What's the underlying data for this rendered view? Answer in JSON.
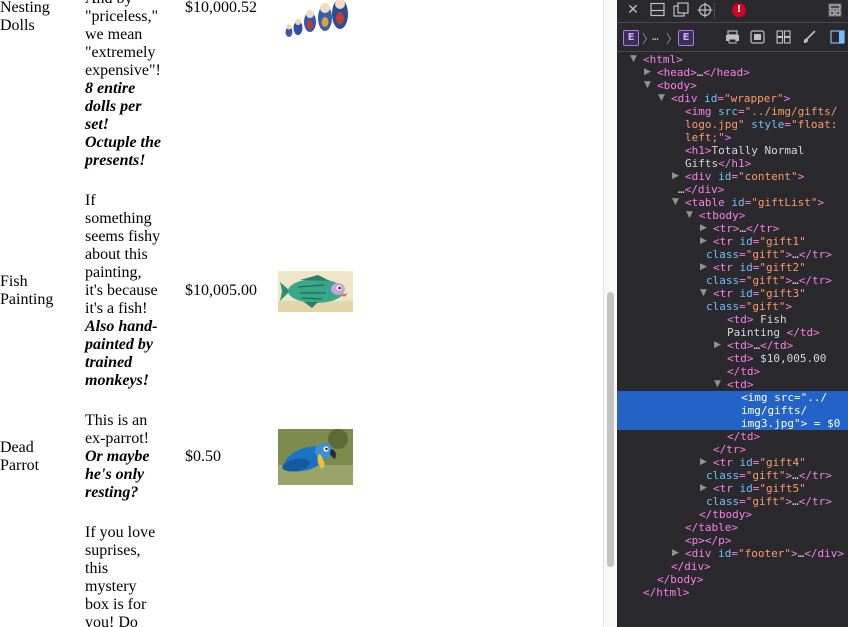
{
  "page": {
    "gifts": [
      {
        "name": "Nesting Dolls",
        "desc_lines": [
          "And by",
          "\"priceless,\"",
          "we mean",
          "\"extremely",
          "expensive\"!"
        ],
        "emph_lines": [
          "8 entire",
          "dolls per",
          "set!",
          "Octuple the",
          "presents!"
        ],
        "price": "$10,000.52",
        "image": "nesting dolls"
      },
      {
        "name": "Fish Painting",
        "desc_lines": [
          "If",
          "something",
          "seems fishy",
          "about this",
          "painting,",
          "it's because",
          "it's a fish!"
        ],
        "emph_lines": [
          "Also hand-",
          "painted by",
          "trained",
          "monkeys!"
        ],
        "price": "$10,005.00",
        "image": "fish painting"
      },
      {
        "name": "Dead Parrot",
        "desc_lines": [
          "This is an",
          "ex-parrot!"
        ],
        "emph_lines": [
          "Or maybe",
          "he's only",
          "resting?"
        ],
        "price": "$0.50",
        "image": "parrot"
      },
      {
        "name": "",
        "desc_lines": [
          "If you love",
          "suprises,",
          "this",
          "mystery",
          "box is for",
          "you! Do"
        ],
        "emph_lines": [],
        "price": "",
        "image": ""
      }
    ]
  },
  "devtools": {
    "toolbar_icons": [
      "close-icon",
      "dock-bottom-icon",
      "undock-icon",
      "pick-element-icon",
      "error-icon",
      "layout-icon"
    ],
    "error_badge": "!",
    "breadcrumb": {
      "left_badge": "E",
      "ellipsis": "…",
      "right_badge": "E"
    },
    "bar_icons": [
      "print-icon",
      "screenshot-icon",
      "grid-icon",
      "paint-brush-icon",
      "sidebar-icon"
    ],
    "selected_suffix": " = $0",
    "tree": [
      {
        "indent": 0,
        "arrow": "▼",
        "tokens": [
          [
            "tag",
            "<html>"
          ]
        ]
      },
      {
        "indent": 1,
        "arrow": "▶",
        "tokens": [
          [
            "tag",
            "<head>"
          ],
          [
            "txt",
            "…"
          ],
          [
            "tag",
            "</head>"
          ]
        ]
      },
      {
        "indent": 1,
        "arrow": "▼",
        "tokens": [
          [
            "tag",
            "<body>"
          ]
        ]
      },
      {
        "indent": 2,
        "arrow": "▼",
        "tokens": [
          [
            "tag",
            "<div "
          ],
          [
            "attr",
            "id"
          ],
          [
            "tag",
            "="
          ],
          [
            "val",
            "\"wrapper\""
          ],
          [
            "tag",
            ">"
          ]
        ]
      },
      {
        "indent": 3,
        "arrow": "",
        "tokens": [
          [
            "tag",
            "<img "
          ],
          [
            "attr",
            "src"
          ],
          [
            "tag",
            "="
          ],
          [
            "val",
            "\"../img/gifts/"
          ]
        ]
      },
      {
        "indent": 3,
        "arrow": "",
        "tokens": [
          [
            "val",
            "logo.jpg\" "
          ],
          [
            "attr",
            "style"
          ],
          [
            "tag",
            "="
          ],
          [
            "val",
            "\"float:"
          ]
        ]
      },
      {
        "indent": 3,
        "arrow": "",
        "tokens": [
          [
            "val",
            "left;\""
          ],
          [
            "tag",
            ">"
          ]
        ]
      },
      {
        "indent": 3,
        "arrow": "",
        "tokens": [
          [
            "tag",
            "<h1>"
          ],
          [
            "txt",
            "Totally Normal"
          ]
        ]
      },
      {
        "indent": 3,
        "arrow": "",
        "tokens": [
          [
            "txt",
            "Gifts"
          ],
          [
            "tag",
            "</h1>"
          ]
        ]
      },
      {
        "indent": 3,
        "arrow": "▶",
        "tokens": [
          [
            "tag",
            "<div "
          ],
          [
            "attr",
            "id"
          ],
          [
            "tag",
            "="
          ],
          [
            "val",
            "\"content\""
          ],
          [
            "tag",
            ">"
          ]
        ]
      },
      {
        "indent": 2.5,
        "arrow": "",
        "tokens": [
          [
            "txt",
            "…"
          ],
          [
            "tag",
            "</div>"
          ]
        ]
      },
      {
        "indent": 3,
        "arrow": "▼",
        "tokens": [
          [
            "tag",
            "<table "
          ],
          [
            "attr",
            "id"
          ],
          [
            "tag",
            "="
          ],
          [
            "val",
            "\"giftList\""
          ],
          [
            "tag",
            ">"
          ]
        ]
      },
      {
        "indent": 4,
        "arrow": "▼",
        "tokens": [
          [
            "tag",
            "<tbody>"
          ]
        ]
      },
      {
        "indent": 5,
        "arrow": "▶",
        "tokens": [
          [
            "tag",
            "<tr>"
          ],
          [
            "txt",
            "…"
          ],
          [
            "tag",
            "</tr>"
          ]
        ]
      },
      {
        "indent": 5,
        "arrow": "▶",
        "tokens": [
          [
            "tag",
            "<tr "
          ],
          [
            "attr",
            "id"
          ],
          [
            "tag",
            "="
          ],
          [
            "val",
            "\"gift1\""
          ]
        ]
      },
      {
        "indent": 4.5,
        "arrow": "",
        "tokens": [
          [
            "attr",
            "class"
          ],
          [
            "tag",
            "="
          ],
          [
            "val",
            "\"gift\""
          ],
          [
            "tag",
            ">"
          ],
          [
            "txt",
            "…"
          ],
          [
            "tag",
            "</tr>"
          ]
        ]
      },
      {
        "indent": 5,
        "arrow": "▶",
        "tokens": [
          [
            "tag",
            "<tr "
          ],
          [
            "attr",
            "id"
          ],
          [
            "tag",
            "="
          ],
          [
            "val",
            "\"gift2\""
          ]
        ]
      },
      {
        "indent": 4.5,
        "arrow": "",
        "tokens": [
          [
            "attr",
            "class"
          ],
          [
            "tag",
            "="
          ],
          [
            "val",
            "\"gift\""
          ],
          [
            "tag",
            ">"
          ],
          [
            "txt",
            "…"
          ],
          [
            "tag",
            "</tr>"
          ]
        ]
      },
      {
        "indent": 5,
        "arrow": "▼",
        "tokens": [
          [
            "tag",
            "<tr "
          ],
          [
            "attr",
            "id"
          ],
          [
            "tag",
            "="
          ],
          [
            "val",
            "\"gift3\""
          ]
        ]
      },
      {
        "indent": 4.5,
        "arrow": "",
        "tokens": [
          [
            "attr",
            "class"
          ],
          [
            "tag",
            "="
          ],
          [
            "val",
            "\"gift\""
          ],
          [
            "tag",
            ">"
          ]
        ]
      },
      {
        "indent": 6,
        "arrow": "",
        "tokens": [
          [
            "tag",
            "<td>"
          ],
          [
            "txt",
            " Fish"
          ]
        ]
      },
      {
        "indent": 6,
        "arrow": "",
        "tokens": [
          [
            "txt",
            "Painting "
          ],
          [
            "tag",
            "</td>"
          ]
        ]
      },
      {
        "indent": 6,
        "arrow": "▶",
        "tokens": [
          [
            "tag",
            "<td>"
          ],
          [
            "txt",
            "…"
          ],
          [
            "tag",
            "</td>"
          ]
        ]
      },
      {
        "indent": 6,
        "arrow": "",
        "tokens": [
          [
            "tag",
            "<td>"
          ],
          [
            "txt",
            " $10,005.00"
          ]
        ]
      },
      {
        "indent": 6,
        "arrow": "",
        "tokens": [
          [
            "tag",
            "</td>"
          ]
        ]
      },
      {
        "indent": 6,
        "arrow": "▼",
        "tokens": [
          [
            "tag",
            "<td>"
          ]
        ]
      },
      {
        "indent": 7,
        "arrow": "",
        "sel": true,
        "tokens": [
          [
            "tag",
            "<img "
          ],
          [
            "attr",
            "src"
          ],
          [
            "tag",
            "="
          ],
          [
            "val",
            "\"../"
          ]
        ]
      },
      {
        "indent": 7,
        "arrow": "",
        "sel": true,
        "tokens": [
          [
            "val",
            "img/gifts/"
          ]
        ]
      },
      {
        "indent": 7,
        "arrow": "",
        "sel": true,
        "last": true,
        "tokens": [
          [
            "val",
            "img3.jpg\""
          ],
          [
            "tag",
            ">"
          ]
        ]
      },
      {
        "indent": 6,
        "arrow": "",
        "tokens": [
          [
            "tag",
            "</td>"
          ]
        ]
      },
      {
        "indent": 5,
        "arrow": "",
        "tokens": [
          [
            "tag",
            "</tr>"
          ]
        ]
      },
      {
        "indent": 5,
        "arrow": "▶",
        "tokens": [
          [
            "tag",
            "<tr "
          ],
          [
            "attr",
            "id"
          ],
          [
            "tag",
            "="
          ],
          [
            "val",
            "\"gift4\""
          ]
        ]
      },
      {
        "indent": 4.5,
        "arrow": "",
        "tokens": [
          [
            "attr",
            "class"
          ],
          [
            "tag",
            "="
          ],
          [
            "val",
            "\"gift\""
          ],
          [
            "tag",
            ">"
          ],
          [
            "txt",
            "…"
          ],
          [
            "tag",
            "</tr>"
          ]
        ]
      },
      {
        "indent": 5,
        "arrow": "▶",
        "tokens": [
          [
            "tag",
            "<tr "
          ],
          [
            "attr",
            "id"
          ],
          [
            "tag",
            "="
          ],
          [
            "val",
            "\"gift5\""
          ]
        ]
      },
      {
        "indent": 4.5,
        "arrow": "",
        "tokens": [
          [
            "attr",
            "class"
          ],
          [
            "tag",
            "="
          ],
          [
            "val",
            "\"gift\""
          ],
          [
            "tag",
            ">"
          ],
          [
            "txt",
            "…"
          ],
          [
            "tag",
            "</tr>"
          ]
        ]
      },
      {
        "indent": 4,
        "arrow": "",
        "tokens": [
          [
            "tag",
            "</tbody>"
          ]
        ]
      },
      {
        "indent": 3,
        "arrow": "",
        "tokens": [
          [
            "tag",
            "</table>"
          ]
        ]
      },
      {
        "indent": 3,
        "arrow": "",
        "tokens": [
          [
            "tag",
            "<p></p>"
          ]
        ]
      },
      {
        "indent": 3,
        "arrow": "▶",
        "tokens": [
          [
            "tag",
            "<div "
          ],
          [
            "attr",
            "id"
          ],
          [
            "tag",
            "="
          ],
          [
            "val",
            "\"footer\""
          ],
          [
            "tag",
            ">"
          ],
          [
            "txt",
            "…"
          ],
          [
            "tag",
            "</div>"
          ]
        ]
      },
      {
        "indent": 2,
        "arrow": "",
        "tokens": [
          [
            "tag",
            "</div>"
          ]
        ]
      },
      {
        "indent": 1,
        "arrow": "",
        "tokens": [
          [
            "tag",
            "</body>"
          ]
        ]
      },
      {
        "indent": 0,
        "arrow": "",
        "tokens": [
          [
            "tag",
            "</html>"
          ]
        ]
      }
    ]
  }
}
